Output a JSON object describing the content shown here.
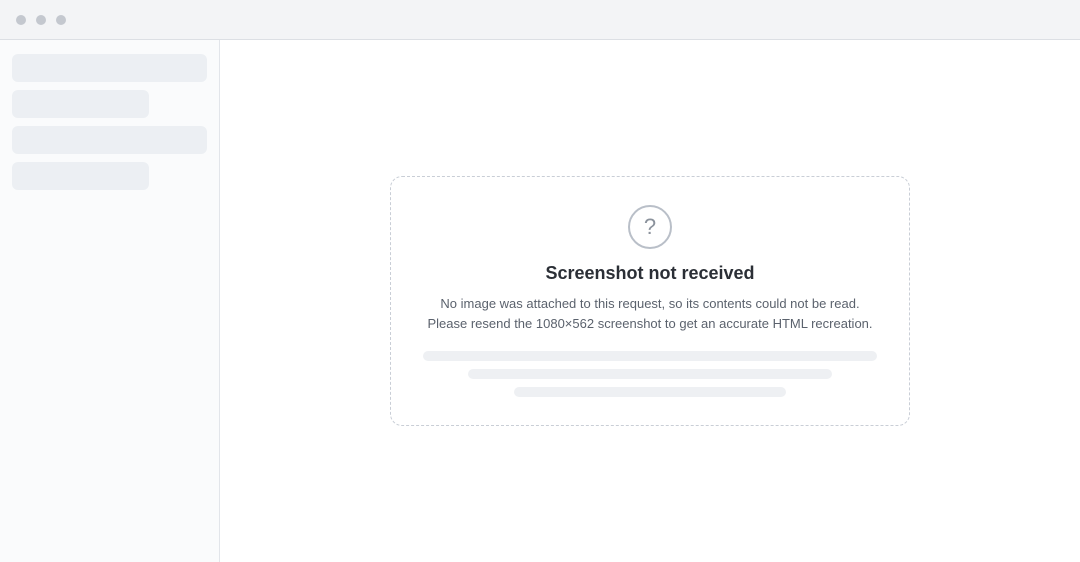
{
  "notice": {
    "title": "Screenshot not received",
    "message": "No image was attached to this request, so its contents could not be read. Please resend the 1080×562 screenshot to get an accurate HTML recreation."
  }
}
